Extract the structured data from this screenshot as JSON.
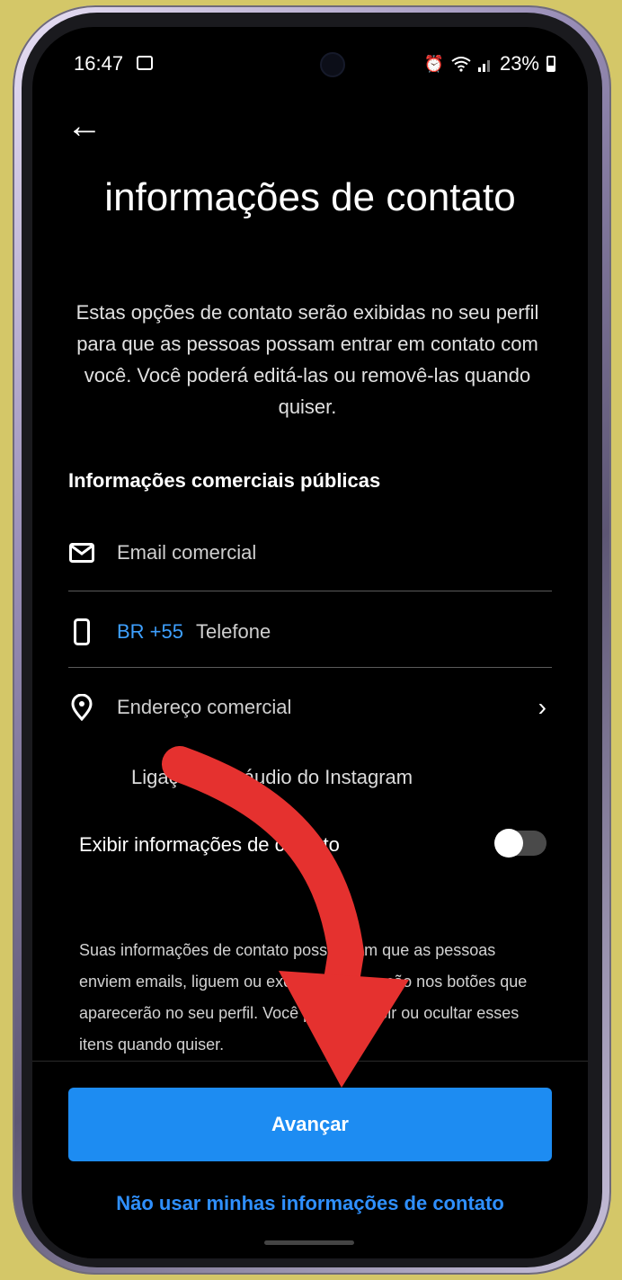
{
  "status_bar": {
    "time": "16:47",
    "battery_percent": "23%"
  },
  "header": {
    "title": "informações de contato",
    "description": "Estas opções de contato serão exibidas no seu perfil para que as pessoas possam entrar em contato com você. Você poderá editá-las ou removê-las quando quiser."
  },
  "public_info": {
    "title": "Informações comerciais públicas",
    "email_placeholder": "Email comercial",
    "phone_country": "BR +55",
    "phone_placeholder": "Telefone",
    "address_label": "Endereço comercial"
  },
  "audio_calls": {
    "label": "Ligações de áudio do Instagram"
  },
  "display_contact": {
    "label": "Exibir informações de contato",
    "enabled": false,
    "info": "Suas informações de contato possibilitam que as pessoas enviem emails, liguem ou executem uma ação nos botões que aparecerão no seu perfil. Você poderá exibir ou ocultar esses itens quando quiser."
  },
  "actions": {
    "next_label": "Avançar",
    "skip_label": "Não usar minhas informações de contato"
  },
  "colors": {
    "accent": "#1d8cf2",
    "link": "#2f90ff",
    "annotation_arrow": "#e5312f"
  }
}
